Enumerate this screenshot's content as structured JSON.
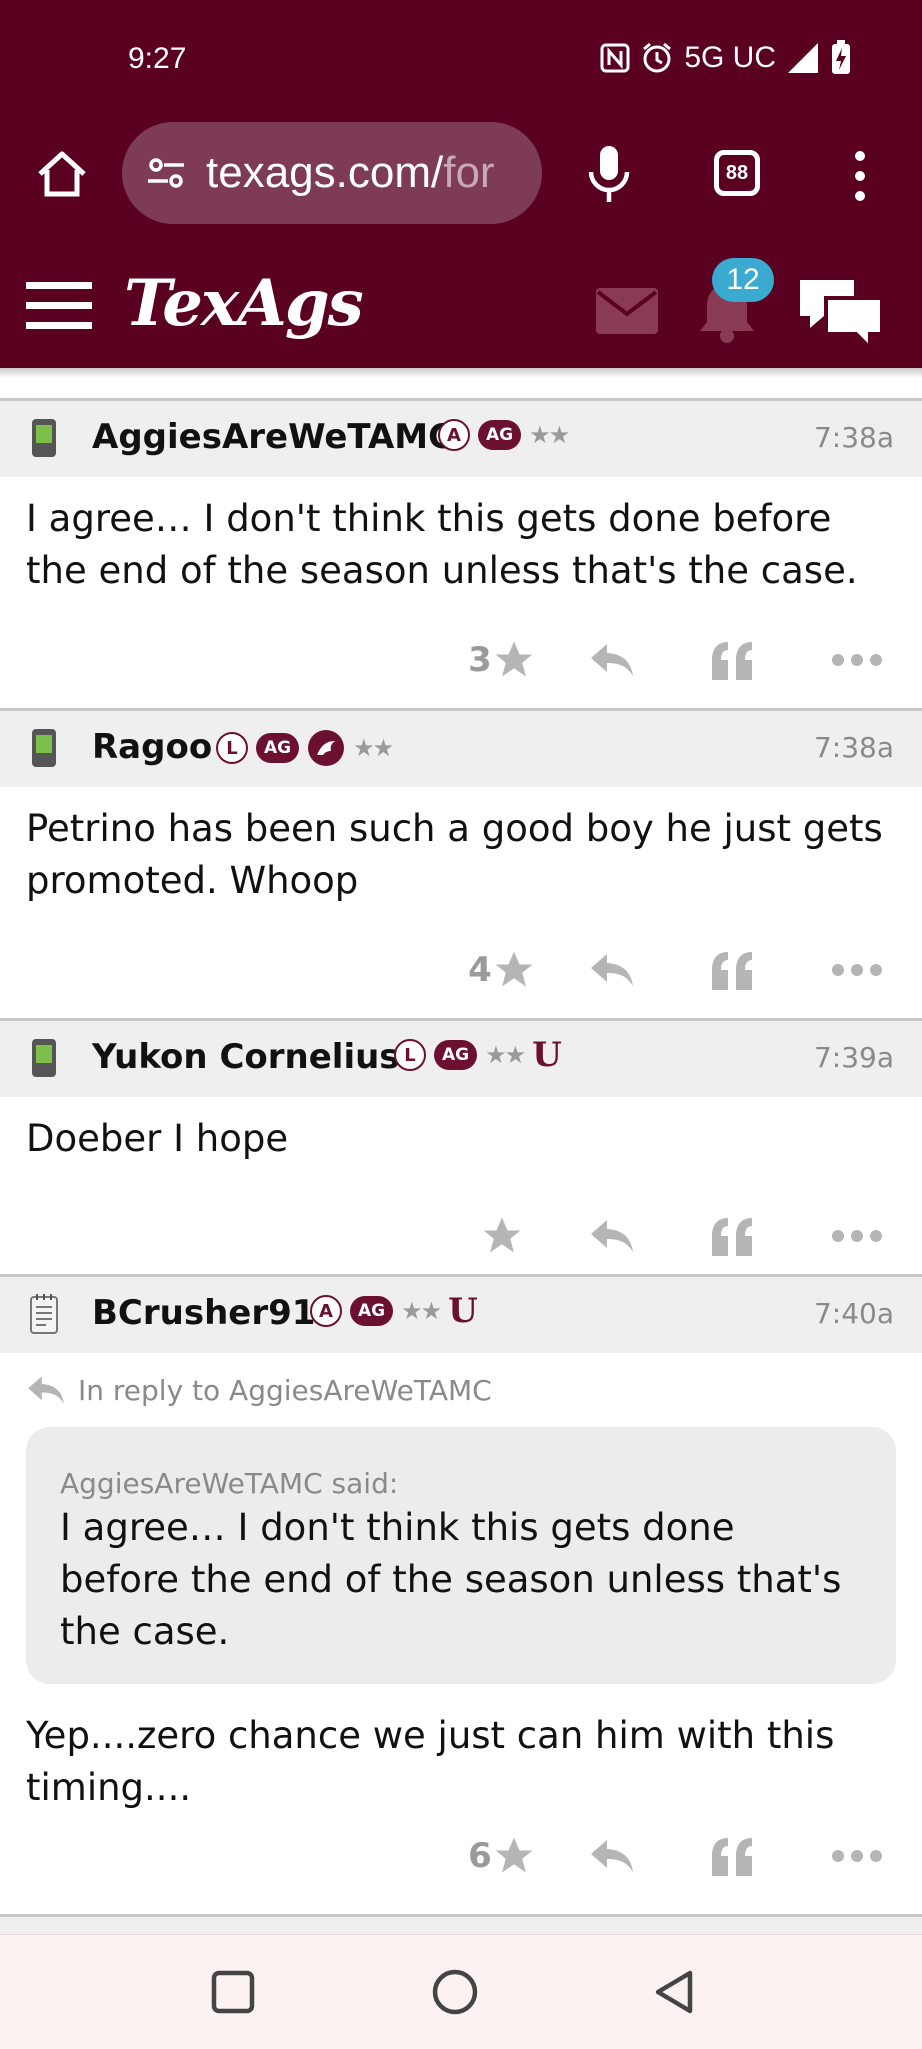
{
  "status_bar": {
    "time": "9:27",
    "network": "5G UC",
    "icons": [
      "nfc-icon",
      "alarm-icon",
      "data-arrows-icon",
      "signal-icon",
      "battery-charging-icon"
    ]
  },
  "browser": {
    "url": "texags.com/for",
    "url_visible": "texags.com/",
    "url_faded": "for",
    "tab_count": "88"
  },
  "site": {
    "logo": "TexAgs",
    "notification_count": "12"
  },
  "posts": [
    {
      "username": "AggiesAreWeTAMC",
      "badges": [
        "A",
        "AG",
        "★★"
      ],
      "time": "7:38a",
      "body": "I agree… I don't think this gets done before the end of the season unless that's the case.",
      "star_count": "3"
    },
    {
      "username": "Ragoo",
      "badges": [
        "L",
        "AG",
        "mascot",
        "★★"
      ],
      "time": "7:38a",
      "body": "Petrino has been such a good boy he just gets promoted. Whoop",
      "star_count": "4"
    },
    {
      "username": "Yukon Cornelius",
      "badges": [
        "L",
        "AG",
        "★★",
        "U"
      ],
      "time": "7:39a",
      "body": "Doeber I hope",
      "star_count": ""
    },
    {
      "username": "BCrusher91",
      "badges": [
        "A",
        "AG",
        "★★",
        "U"
      ],
      "time": "7:40a",
      "reply_to": "In reply to AggiesAreWeTAMC",
      "quote_attribution": "AggiesAreWeTAMC said:",
      "quote_text": "I agree… I don't think this gets done before the end of the season unless that's the case.",
      "body": "Yep....zero chance we just can him with this timing....",
      "star_count": "6"
    }
  ],
  "colors": {
    "maroon": "#5a0020",
    "badge_maroon": "#6b1030",
    "badge_blue": "#3aaad1",
    "header_gray": "#efefef"
  }
}
